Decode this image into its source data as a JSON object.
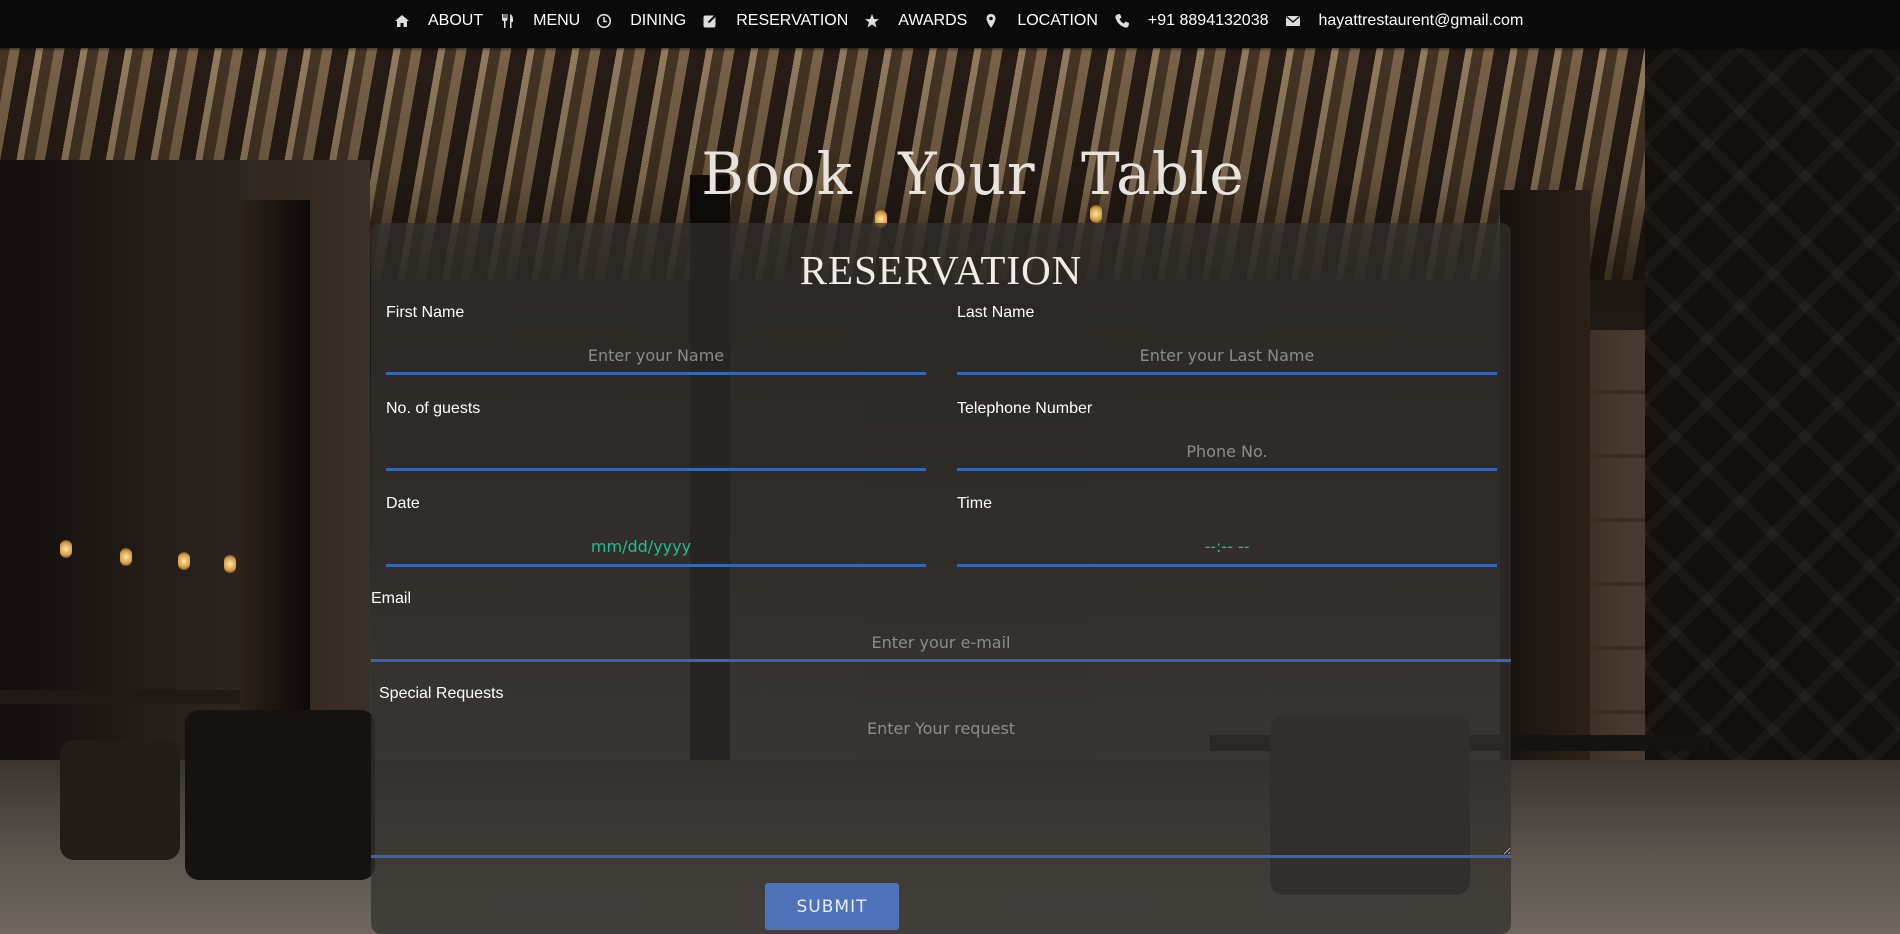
{
  "navbar": {
    "items": [
      {
        "icon": "home-icon",
        "label": "ABOUT"
      },
      {
        "icon": "cutlery-icon",
        "label": "MENU"
      },
      {
        "icon": "clock-icon",
        "label": "DINING"
      },
      {
        "icon": "edit-icon",
        "label": "RESERVATION"
      },
      {
        "icon": "star-icon",
        "label": "AWARDS"
      },
      {
        "icon": "map-marker-icon",
        "label": "LOCATION"
      },
      {
        "icon": "phone-icon",
        "label": "+91 8894132038"
      },
      {
        "icon": "envelope-icon",
        "label": "hayattrestaurent@gmail.com"
      }
    ]
  },
  "page": {
    "title": "Book Your Table"
  },
  "form": {
    "title": "RESERVATION",
    "first_name": {
      "label": "First Name",
      "placeholder": "Enter your Name",
      "value": ""
    },
    "last_name": {
      "label": "Last Name",
      "placeholder": "Enter your Last Name",
      "value": ""
    },
    "guests": {
      "label": "No. of guests",
      "placeholder": "",
      "value": ""
    },
    "telephone": {
      "label": "Telephone Number",
      "placeholder": "Phone No.",
      "value": ""
    },
    "date": {
      "label": "Date",
      "value": "mm/dd/yyyy"
    },
    "time": {
      "label": "Time",
      "value": "--:-- --"
    },
    "email": {
      "label": "Email",
      "placeholder": "Enter your e-mail",
      "value": ""
    },
    "special_requests": {
      "label": "Special Requests",
      "placeholder": "Enter Your request"
    },
    "submit_label": "SUBMIT"
  },
  "colors": {
    "navbar_bg": "#0a0a0a",
    "input_underline": "#3a64b4",
    "submit_bg": "#4e73bb",
    "date_time_text": "#1fbf93",
    "placeholder_text": "#8c8c8c"
  }
}
